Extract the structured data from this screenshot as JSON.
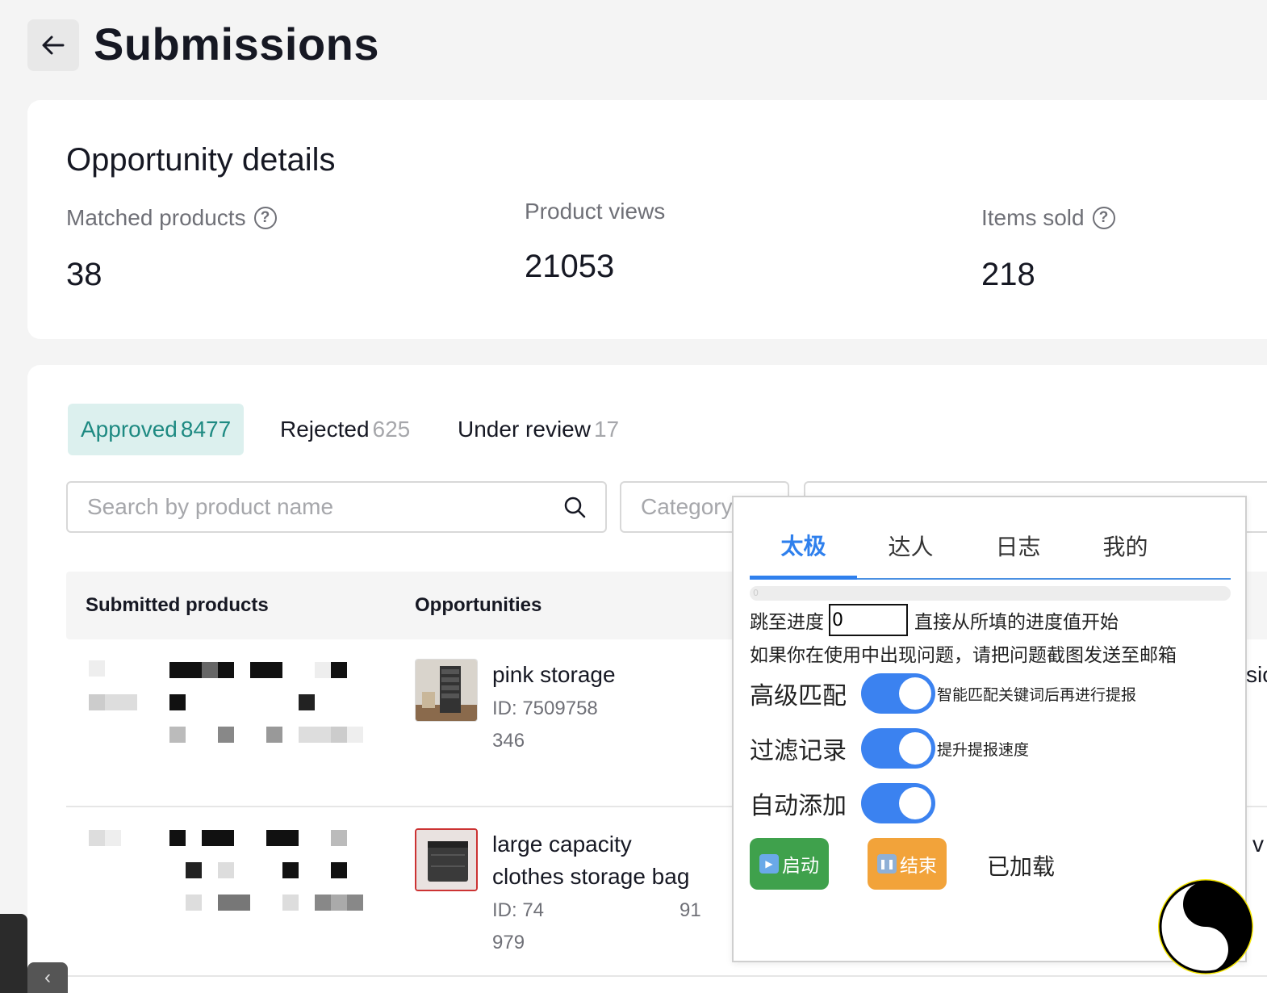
{
  "header": {
    "title": "Submissions",
    "back_icon": "arrow-left-icon"
  },
  "details": {
    "title": "Opportunity details",
    "metrics": [
      {
        "label": "Matched products",
        "value": "38",
        "help": true
      },
      {
        "label": "Product views",
        "value": "21053",
        "help": false
      },
      {
        "label": "Items sold",
        "value": "218",
        "help": true
      }
    ]
  },
  "tabs": [
    {
      "label": "Approved",
      "count": "8477",
      "active": true
    },
    {
      "label": "Rejected",
      "count": "625",
      "active": false
    },
    {
      "label": "Under review",
      "count": "17",
      "active": false
    }
  ],
  "filters": {
    "search_placeholder": "Search by product name",
    "category_placeholder": "Category"
  },
  "table": {
    "headers": [
      "Submitted products",
      "Opportunities"
    ],
    "rows": [
      {
        "name": "pink storage",
        "id_line1": "ID: 7509758",
        "id_line2": "346"
      },
      {
        "name": "large capacity clothes storage bag",
        "id_line1": "ID: 74",
        "id_line1_tail": "91",
        "id_line2": "979"
      }
    ]
  },
  "edge_fragments": {
    "row1": "sic",
    "row2": "v"
  },
  "plugin": {
    "tabs": [
      "太极",
      "达人",
      "日志",
      "我的"
    ],
    "active_tab": "太极",
    "progress_text": "0",
    "jump_label": "跳至进度",
    "jump_value": "0",
    "jump_hint": "直接从所填的进度值开始",
    "help_text": "如果你在使用中出现问题，请把问题截图发送至邮箱",
    "options": [
      {
        "label": "高级匹配",
        "desc": "智能匹配关键词后再进行提报",
        "on": true
      },
      {
        "label": "过滤记录",
        "desc": "提升提报速度",
        "on": true
      },
      {
        "label": "自动添加",
        "desc": "",
        "on": true
      }
    ],
    "start_label": "启动",
    "stop_label": "结束",
    "status": "已加载",
    "accent": "#2f80ed"
  }
}
